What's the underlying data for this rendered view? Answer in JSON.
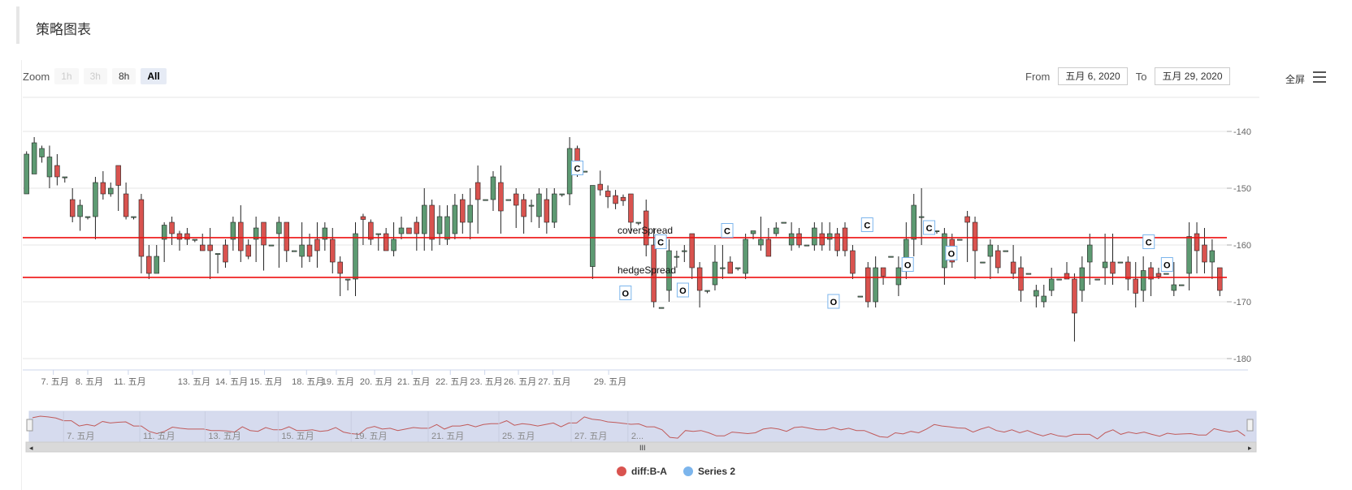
{
  "header": {
    "title": "策略图表"
  },
  "zoom": {
    "label": "Zoom",
    "buttons": [
      {
        "label": "1h",
        "state": "disabled"
      },
      {
        "label": "3h",
        "state": "disabled"
      },
      {
        "label": "8h",
        "state": "enabled"
      },
      {
        "label": "All",
        "state": "selected"
      }
    ]
  },
  "range": {
    "from_label": "From",
    "from_value": "五月 6, 2020",
    "to_label": "To",
    "to_value": "五月 29, 2020"
  },
  "toolbar": {
    "fullscreen_label": "全屏",
    "menu_icon": "hamburger-menu-icon"
  },
  "colors": {
    "up": "#5d9a72",
    "down": "#d9534f",
    "wick": "#222222",
    "line": "#ee1111",
    "navigator_fill": "#d6dbee",
    "navigator_line": "#c05a5a",
    "flag_border": "#7cb5ec"
  },
  "chart_data": {
    "type": "candlestick",
    "title": "",
    "xlabel": "",
    "ylabel": "",
    "ylim": [
      -182,
      -134
    ],
    "y_ticks": [
      -140,
      -150,
      -160,
      -170,
      -180
    ],
    "y_tick_labels": [
      "-140",
      "-150",
      "-160",
      "-170",
      "-180"
    ],
    "x_ticks": [
      {
        "label": "7. 五月",
        "x": 4.0
      },
      {
        "label": "8. 五月",
        "x": 8.5
      },
      {
        "label": "11. 五月",
        "x": 13.8
      },
      {
        "label": "13. 五月",
        "x": 22.2
      },
      {
        "label": "14. 五月",
        "x": 27.1
      },
      {
        "label": "15. 五月",
        "x": 31.6
      },
      {
        "label": "18. 五月",
        "x": 37.1
      },
      {
        "label": "19. 五月",
        "x": 41.0
      },
      {
        "label": "20. 五月",
        "x": 46.0
      },
      {
        "label": "21. 五月",
        "x": 50.9
      },
      {
        "label": "22. 五月",
        "x": 55.9
      },
      {
        "label": "23. 五月",
        "x": 60.4
      },
      {
        "label": "26. 五月",
        "x": 64.8
      },
      {
        "label": "27. 五月",
        "x": 69.3
      },
      {
        "label": "29. 五月",
        "x": 76.6
      }
    ],
    "series": [
      {
        "name": "diff:B-A",
        "type": "candlestick",
        "ohlc": [
          [
            -151,
            -144,
            -148,
            -143.5
          ],
          [
            -147.5,
            -142,
            -144.5,
            -141
          ],
          [
            -144.5,
            -143,
            -145.5,
            -142.5
          ],
          [
            -148,
            -144.5,
            -150,
            -142.5
          ],
          [
            -146,
            -148,
            -149.5,
            -144
          ],
          [
            -148,
            -148,
            -149,
            -148
          ],
          [
            -152,
            -155,
            -156,
            -150
          ],
          [
            -155,
            -153,
            -157.5,
            -152
          ],
          [
            -155,
            -155,
            -155.5,
            -155
          ],
          [
            -155,
            -149,
            -159,
            -148
          ],
          [
            -149,
            -151,
            -152,
            -147
          ],
          [
            -151,
            -150,
            -151.5,
            -149
          ],
          [
            -146,
            -149.5,
            -154,
            -146
          ],
          [
            -151,
            -155,
            -155.5,
            -149
          ],
          [
            -155,
            -155,
            -155.5,
            -155
          ],
          [
            -152,
            -162,
            -165,
            -151
          ],
          [
            -162,
            -165,
            -166,
            -160
          ],
          [
            -165,
            -162,
            -164,
            -160
          ],
          [
            -159,
            -156.5,
            -163,
            -156
          ],
          [
            -156,
            -158,
            -160,
            -155
          ],
          [
            -158,
            -159,
            -161,
            -157.5
          ],
          [
            -158,
            -159,
            -160,
            -157
          ],
          [
            -159,
            -159,
            -159.5,
            -159
          ],
          [
            -160,
            -161,
            -161,
            -158
          ],
          [
            -160,
            -161,
            -166,
            -157
          ],
          [
            -161.5,
            -161.5,
            -165,
            -161.5
          ],
          [
            -160,
            -163,
            -164,
            -159
          ],
          [
            -159,
            -156,
            -161,
            -155
          ],
          [
            -156,
            -161,
            -163,
            -153
          ],
          [
            -160,
            -162,
            -162.5,
            -159
          ],
          [
            -159,
            -157,
            -163,
            -155
          ],
          [
            -156,
            -160,
            -164.5,
            -156
          ],
          [
            -160,
            -160,
            -160,
            -160
          ],
          [
            -158,
            -156,
            -164,
            -155
          ],
          [
            -156,
            -161,
            -163,
            -156
          ],
          [
            -161,
            -161,
            -161,
            -161
          ],
          [
            -162,
            -160,
            -164,
            -156
          ],
          [
            -160,
            -162,
            -163,
            -158
          ],
          [
            -159,
            -161,
            -164,
            -156
          ],
          [
            -159,
            -157,
            -161,
            -156
          ],
          [
            -159,
            -163,
            -165,
            -157
          ],
          [
            -163,
            -165,
            -169,
            -162
          ],
          [
            -166,
            -166,
            -168,
            -166
          ],
          [
            -166,
            -158,
            -169,
            -156
          ],
          [
            -155,
            -155.5,
            -160,
            -154.5
          ],
          [
            -156,
            -159,
            -160,
            -155.5
          ],
          [
            -158,
            -158,
            -161,
            -158
          ],
          [
            -158,
            -161,
            -161,
            -157
          ],
          [
            -161,
            -159,
            -162,
            -156
          ],
          [
            -158,
            -157,
            -159,
            -155
          ],
          [
            -157,
            -158,
            -158,
            -157
          ],
          [
            -156,
            -158,
            -161,
            -155
          ],
          [
            -158,
            -153,
            -161,
            -150
          ],
          [
            -153,
            -159,
            -161,
            -152
          ],
          [
            -158,
            -155,
            -160,
            -153
          ],
          [
            -159,
            -155,
            -160,
            -153
          ],
          [
            -158,
            -153,
            -159,
            -151
          ],
          [
            -152,
            -156,
            -158,
            -151
          ],
          [
            -156,
            -153,
            -159,
            -150
          ],
          [
            -149,
            -152,
            -158,
            -146
          ],
          [
            -152,
            -152,
            -152,
            -152
          ],
          [
            -152,
            -148,
            -154,
            -147
          ],
          [
            -149,
            -154,
            -158,
            -146
          ],
          [
            -152,
            -152,
            -152,
            -152
          ],
          [
            -151,
            -153,
            -157,
            -150
          ],
          [
            -152,
            -155,
            -158,
            -151
          ],
          [
            -153,
            -153,
            -156,
            -152
          ],
          [
            -155,
            -151,
            -157,
            -150
          ],
          [
            -152,
            -156,
            -158,
            -150
          ],
          [
            -156,
            -151,
            -157,
            -150
          ],
          [
            -151,
            -151,
            -151.5,
            -151
          ],
          [
            -151,
            -143,
            -153,
            -141
          ],
          [
            -143,
            -146,
            -148,
            -142.5
          ],
          [
            -147,
            -147,
            -147,
            -147
          ],
          [
            -163.8,
            -149.5,
            -166,
            -149.5
          ],
          [
            -149.3,
            -150.3,
            -151.3,
            -146.9
          ],
          [
            -150.5,
            -151.5,
            -153.5,
            -149.5
          ],
          [
            -151.3,
            -152.7,
            -153.7,
            -150.3
          ],
          [
            -151.6,
            -152.2,
            -153.1,
            -151.1
          ],
          [
            -151,
            -156,
            -158,
            -151
          ],
          [
            -156,
            -156,
            -156.5,
            -156
          ],
          [
            -154,
            -160,
            -162,
            -152
          ],
          [
            -160,
            -170,
            -171,
            -157
          ],
          [
            -171,
            -171,
            -171,
            -171
          ],
          [
            -168,
            -161,
            -170,
            -159
          ],
          [
            -162,
            -162,
            -164,
            -161
          ],
          [
            -161,
            -161,
            -163,
            -160
          ],
          [
            -158,
            -164,
            -166,
            -158
          ],
          [
            -164,
            -168,
            -171,
            -163
          ],
          [
            -168,
            -168,
            -168.5,
            -168
          ],
          [
            -167,
            -163,
            -168,
            -160
          ],
          [
            -164,
            -164,
            -166,
            -160
          ],
          [
            -163,
            -165,
            -165,
            -162
          ],
          [
            -164,
            -164,
            -164.5,
            -164
          ],
          [
            -165,
            -159,
            -166,
            -158
          ],
          [
            -158,
            -157.5,
            -159,
            -157.5
          ],
          [
            -160,
            -159,
            -161,
            -155
          ],
          [
            -159,
            -162,
            -162,
            -157
          ],
          [
            -158,
            -157,
            -158.5,
            -156
          ],
          [
            -156,
            -156,
            -156,
            -156
          ],
          [
            -160,
            -158,
            -161,
            -156
          ],
          [
            -158,
            -160,
            -160.5,
            -157
          ],
          [
            -160,
            -160,
            -160,
            -160
          ],
          [
            -160,
            -157,
            -161,
            -156
          ],
          [
            -158,
            -160,
            -161,
            -156
          ],
          [
            -159,
            -158,
            -161,
            -156
          ],
          [
            -158,
            -161,
            -162,
            -157
          ],
          [
            -157,
            -161,
            -162,
            -156
          ],
          [
            -161,
            -165,
            -166,
            -160
          ],
          [
            -169,
            -169,
            -169,
            -169
          ],
          [
            -164,
            -170,
            -171,
            -163
          ],
          [
            -170,
            -164,
            -171,
            -162
          ],
          [
            -164,
            -165.5,
            -167,
            -164
          ],
          [
            -162,
            -162,
            -162,
            -162
          ],
          [
            -167,
            -164,
            -169,
            -162
          ],
          [
            -164,
            -159,
            -166,
            -156
          ],
          [
            -159,
            -153,
            -162,
            -151
          ],
          [
            -155,
            -155,
            -160,
            -150
          ],
          [
            -156,
            -156,
            -156,
            -156
          ],
          [
            -157.5,
            -157.5,
            -158,
            -157.5
          ],
          [
            -164,
            -158,
            -167,
            -157
          ],
          [
            -159,
            -163,
            -164,
            -158
          ],
          [
            -159,
            -159,
            -159,
            -159
          ],
          [
            -155,
            -156,
            -163,
            -154
          ],
          [
            -156,
            -161,
            -166,
            -155
          ],
          [
            -163,
            -163,
            -163,
            -163
          ],
          [
            -162,
            -160,
            -166,
            -159
          ],
          [
            -161,
            -164,
            -165,
            -160
          ],
          [
            -161,
            -161,
            -161,
            -161
          ],
          [
            -163,
            -165,
            -166,
            -160
          ],
          [
            -164,
            -168,
            -170,
            -162
          ],
          [
            -165,
            -165,
            -165,
            -165
          ],
          [
            -169,
            -168,
            -171,
            -167
          ],
          [
            -170,
            -169,
            -171,
            -167
          ],
          [
            -168,
            -166,
            -169,
            -164
          ],
          [
            -166,
            -166,
            -166,
            -166
          ],
          [
            -165,
            -166,
            -166,
            -163
          ],
          [
            -166,
            -172,
            -177,
            -165
          ],
          [
            -168,
            -164,
            -170,
            -162
          ],
          [
            -163,
            -160,
            -167,
            -158
          ],
          [
            -166,
            -166,
            -166,
            -166
          ],
          [
            -164,
            -163,
            -167,
            -158
          ],
          [
            -163,
            -165,
            -167,
            -158
          ],
          [
            -163,
            -163,
            -163,
            -163
          ],
          [
            -163,
            -166,
            -168,
            -162
          ],
          [
            -166,
            -168.5,
            -171,
            -163
          ],
          [
            -168,
            -164.5,
            -170,
            -162
          ],
          [
            -164,
            -166,
            -169,
            -163
          ],
          [
            -165,
            -165.5,
            -166,
            -164
          ],
          [
            -165,
            -165,
            -165,
            -165
          ],
          [
            -168,
            -167,
            -169,
            -163
          ],
          [
            -167,
            -167,
            -167,
            -167
          ],
          [
            -165,
            -158.5,
            -168,
            -156
          ],
          [
            -158,
            -161,
            -165,
            -156
          ],
          [
            -160,
            -163,
            -165,
            -157
          ],
          [
            -163,
            -161,
            -166,
            -159
          ],
          [
            -164,
            -168,
            -169,
            -164
          ]
        ]
      },
      {
        "name": "Series 2",
        "type": "flags",
        "flags": [
          {
            "x": 72.5,
            "y": -146.5,
            "text": "C"
          },
          {
            "x": 78.8,
            "y": -168.5,
            "text": "O"
          },
          {
            "x": 83.4,
            "y": -159.5,
            "text": "C"
          },
          {
            "x": 86.3,
            "y": -168,
            "text": "O"
          },
          {
            "x": 92.1,
            "y": -157.5,
            "text": "C"
          },
          {
            "x": 106.0,
            "y": -170,
            "text": "O"
          },
          {
            "x": 110.4,
            "y": -156.5,
            "text": "C"
          },
          {
            "x": 115.7,
            "y": -163.5,
            "text": "O"
          },
          {
            "x": 118.5,
            "y": -157,
            "text": "C"
          },
          {
            "x": 121.4,
            "y": -161.5,
            "text": "O"
          },
          {
            "x": 147.2,
            "y": -159.5,
            "text": "C"
          },
          {
            "x": 149.6,
            "y": -163.5,
            "text": "O"
          }
        ]
      }
    ],
    "hlines": [
      {
        "y": -158.7,
        "label": "coverSpread"
      },
      {
        "y": -165.7,
        "label": "hedgeSpread"
      }
    ],
    "navigator": {
      "x_labels": [
        {
          "label": "7. 五月",
          "x": 4.0
        },
        {
          "label": "11. 五月",
          "x": 13.8
        },
        {
          "label": "13. 五月",
          "x": 22.2
        },
        {
          "label": "15. 五月",
          "x": 31.6
        },
        {
          "label": "19. 五月",
          "x": 41.0
        },
        {
          "label": "21. 五月",
          "x": 50.9
        },
        {
          "label": "25. 五月",
          "x": 60.0
        },
        {
          "label": "27. 五月",
          "x": 69.3
        },
        {
          "label": "2...",
          "x": 76.6
        }
      ]
    }
  },
  "legend": [
    {
      "label": "diff:B-A",
      "color": "#d9534f"
    },
    {
      "label": "Series 2",
      "color": "#7cb5ec"
    }
  ]
}
